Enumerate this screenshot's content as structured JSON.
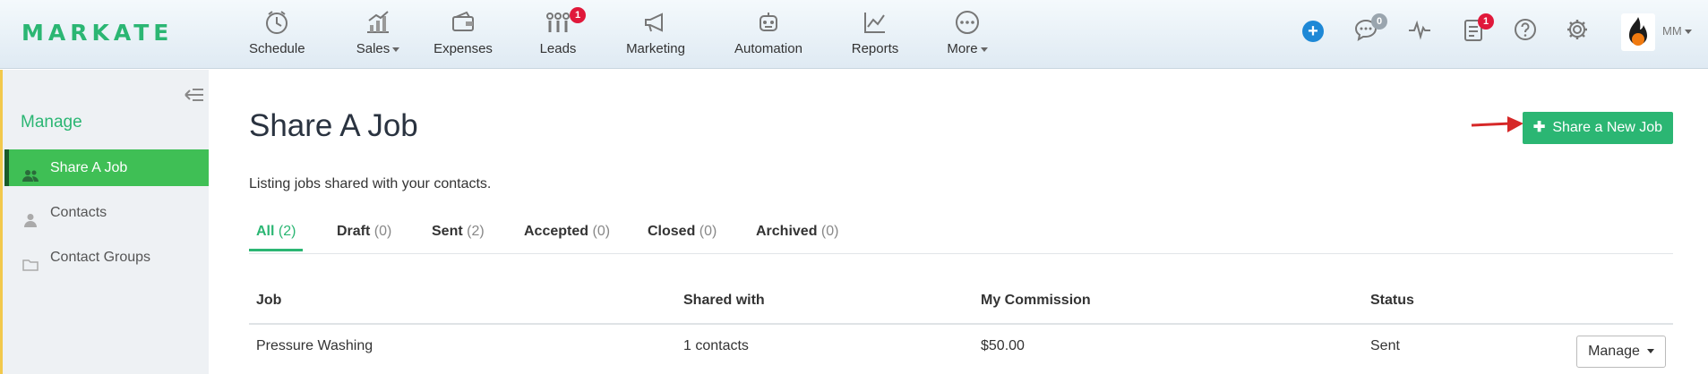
{
  "brand": {
    "logo": "MARKATE",
    "accent": "#2bb673"
  },
  "nav": {
    "schedule": "Schedule",
    "sales": "Sales",
    "expenses": "Expenses",
    "leads": "Leads",
    "leads_badge": "1",
    "marketing": "Marketing",
    "automation": "Automation",
    "reports": "Reports",
    "more": "More"
  },
  "topright": {
    "chat_badge": "0",
    "tasks_badge": "1",
    "user_initials": "MM"
  },
  "sidebar": {
    "title": "Manage",
    "items": [
      {
        "label": "Share A Job",
        "icon": "users-icon"
      },
      {
        "label": "Contacts",
        "icon": "user-icon"
      },
      {
        "label": "Contact Groups",
        "icon": "folder-icon"
      }
    ]
  },
  "main": {
    "title": "Share A Job",
    "subtitle": "Listing jobs shared with your contacts.",
    "new_job_button": "Share a New Job",
    "tabs": [
      {
        "label": "All",
        "count": "(2)"
      },
      {
        "label": "Draft",
        "count": "(0)"
      },
      {
        "label": "Sent",
        "count": "(2)"
      },
      {
        "label": "Accepted",
        "count": "(0)"
      },
      {
        "label": "Closed",
        "count": "(0)"
      },
      {
        "label": "Archived",
        "count": "(0)"
      }
    ],
    "table": {
      "columns": [
        "Job",
        "Shared with",
        "My Commission",
        "Status"
      ],
      "rows": [
        {
          "job": "Pressure Washing",
          "shared_with": "1 contacts",
          "commission": "$50.00",
          "status": "Sent",
          "action": "Manage"
        }
      ]
    }
  }
}
